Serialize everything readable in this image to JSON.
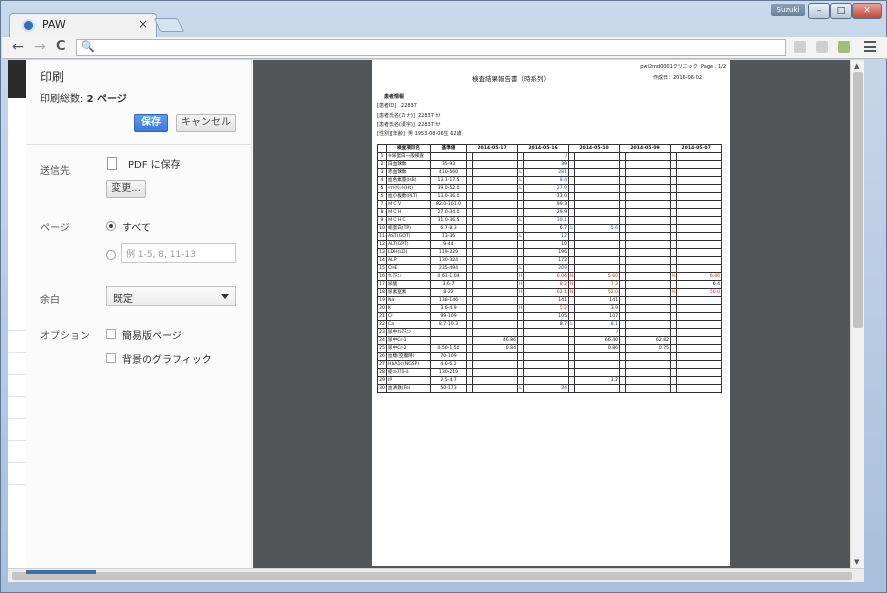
{
  "browser": {
    "tab_title": "PAW",
    "tab_close": "×",
    "user_badge": "Suzuki",
    "window_buttons": {
      "min": "–",
      "max": "□",
      "close": "✕"
    },
    "nav": {
      "back": "←",
      "forward": "→",
      "reload": "C",
      "search": "🔍"
    },
    "address": ""
  },
  "print": {
    "title": "印刷",
    "total_label": "印刷総数:",
    "total_value": "2 ページ",
    "save_button": "保存",
    "cancel_button": "キャンセル",
    "destination_label": "送信先",
    "destination_value": "PDF に保存",
    "change_button": "変更...",
    "pages_label": "ページ",
    "pages_all": "すべて",
    "pages_placeholder": "例 1-5, 8, 11-13",
    "margin_label": "余白",
    "margin_value": "既定",
    "options_label": "オプション",
    "option_simple": "簡易版ページ",
    "option_background": "背景のグラフィック"
  },
  "document": {
    "clinic": "pwi2md0001クリニック",
    "page_label": "Page : 1/2",
    "title": "検査結果報告書（時系列）",
    "created": "作成日：2016-06-02",
    "patient_section": "患者情報",
    "patient": [
      {
        "k": "[患者ID]",
        "v": "22837"
      },
      {
        "k": "[患者氏名(カナ)]",
        "v": "22837 ｶﾅ"
      },
      {
        "k": "[患者氏名(漢字)]",
        "v": "22837 ｶﾅ"
      },
      {
        "k": "[性別][年齢]",
        "v": "男 1953-08-06生 62歳"
      }
    ],
    "headers": [
      "",
      "検査項目名",
      "基準値",
      "2014-05-17",
      "2014-05-16",
      "2014-05-10",
      "2014-05-09",
      "2014-05-07"
    ],
    "rows": [
      {
        "n": "1",
        "name": "※尿蛋白一般検査",
        "ref": "",
        "v": [
          [
            "",
            ""
          ],
          [
            "",
            "/"
          ],
          [
            "",
            ""
          ],
          [
            "",
            ""
          ],
          [
            "",
            ""
          ]
        ]
      },
      {
        "n": "2",
        "name": "白血球数",
        "ref": "35-93",
        "v": [
          [
            "",
            ""
          ],
          [
            "",
            "39"
          ],
          [
            "",
            ""
          ],
          [
            "",
            ""
          ],
          [
            "",
            ""
          ]
        ]
      },
      {
        "n": "3",
        "name": "赤血球数",
        "ref": "410-560",
        "v": [
          [
            "",
            ""
          ],
          [
            "L",
            "281"
          ],
          [
            "",
            ""
          ],
          [
            "",
            ""
          ],
          [
            "",
            ""
          ]
        ]
      },
      {
        "n": "4",
        "name": "血色素量(HB)",
        "ref": "13.1-17.5",
        "v": [
          [
            "",
            ""
          ],
          [
            "L",
            "8.4"
          ],
          [
            "",
            ""
          ],
          [
            "",
            ""
          ],
          [
            "",
            ""
          ]
        ]
      },
      {
        "n": "5",
        "name": "ﾍﾏﾄｸﾘｯﾄ(Ht)",
        "ref": "39.0-52.0",
        "v": [
          [
            "",
            ""
          ],
          [
            "L",
            "27.9"
          ],
          [
            "",
            ""
          ],
          [
            "",
            ""
          ],
          [
            "",
            ""
          ]
        ]
      },
      {
        "n": "6",
        "name": "血小板数(PLT)",
        "ref": "13.0-36.0",
        "v": [
          [
            "",
            ""
          ],
          [
            "",
            "33.0"
          ],
          [
            "",
            ""
          ],
          [
            "",
            ""
          ],
          [
            "",
            ""
          ]
        ]
      },
      {
        "n": "7",
        "name": "ＭＣＶ",
        "ref": "82.0-101.0",
        "v": [
          [
            "",
            ""
          ],
          [
            "",
            "99.3"
          ],
          [
            "",
            ""
          ],
          [
            "",
            ""
          ],
          [
            "",
            ""
          ]
        ]
      },
      {
        "n": "8",
        "name": "ＭＣＨ",
        "ref": "27.0-34.0",
        "v": [
          [
            "",
            ""
          ],
          [
            "",
            "29.9"
          ],
          [
            "",
            ""
          ],
          [
            "",
            ""
          ],
          [
            "",
            ""
          ]
        ]
      },
      {
        "n": "9",
        "name": "ＭＣＨＣ",
        "ref": "31.0-36.5",
        "v": [
          [
            "",
            ""
          ],
          [
            "L",
            "30.1"
          ],
          [
            "",
            ""
          ],
          [
            "",
            ""
          ],
          [
            "",
            ""
          ]
        ]
      },
      {
        "n": "10",
        "name": "総蛋白(TP)",
        "ref": "6.7-8.3",
        "v": [
          [
            "",
            ""
          ],
          [
            "",
            "6.7"
          ],
          [
            "L",
            "5.6"
          ],
          [
            "",
            ""
          ],
          [
            "",
            ""
          ]
        ]
      },
      {
        "n": "11",
        "name": "AST(GOT)",
        "ref": "13-36",
        "v": [
          [
            "",
            ""
          ],
          [
            "L",
            "12"
          ],
          [
            "",
            ""
          ],
          [
            "",
            ""
          ],
          [
            "",
            ""
          ]
        ]
      },
      {
        "n": "12",
        "name": "ALT(GPT)",
        "ref": "9-44",
        "v": [
          [
            "",
            ""
          ],
          [
            "",
            "10"
          ],
          [
            "",
            ""
          ],
          [
            "",
            ""
          ],
          [
            "",
            ""
          ]
        ]
      },
      {
        "n": "13",
        "name": "LDH(LD)",
        "ref": "119-229",
        "v": [
          [
            "",
            ""
          ],
          [
            "",
            "196"
          ],
          [
            "",
            ""
          ],
          [
            "",
            ""
          ],
          [
            "",
            ""
          ]
        ]
      },
      {
        "n": "14",
        "name": "ALP",
        "ref": "130-324",
        "v": [
          [
            "",
            ""
          ],
          [
            "",
            "172"
          ],
          [
            "",
            ""
          ],
          [
            "",
            ""
          ],
          [
            "",
            ""
          ]
        ]
      },
      {
        "n": "15",
        "name": "CHE",
        "ref": "235-494",
        "v": [
          [
            "",
            ""
          ],
          [
            "L",
            "209"
          ],
          [
            "",
            ""
          ],
          [
            "",
            ""
          ],
          [
            "",
            ""
          ]
        ]
      },
      {
        "n": "16",
        "name": "ｸﾚｱﾁﾆﾝ",
        "ref": "0.61-1.04",
        "v": [
          [
            "",
            ""
          ],
          [
            "H",
            "6.06"
          ],
          [
            "H",
            "5.60"
          ],
          [
            "",
            ""
          ],
          [
            "H",
            "6.06"
          ]
        ]
      },
      {
        "n": "17",
        "name": "尿酸",
        "ref": "3.6-7",
        "v": [
          [
            "",
            ""
          ],
          [
            "H",
            "8.2"
          ],
          [
            "H",
            "7.3"
          ],
          [
            "",
            ""
          ],
          [
            "",
            "6.4"
          ]
        ]
      },
      {
        "n": "18",
        "name": "尿素窒素",
        "ref": "8-22",
        "v": [
          [
            "",
            ""
          ],
          [
            "H",
            "62.1"
          ],
          [
            "H",
            "52.0"
          ],
          [
            "",
            ""
          ],
          [
            "H",
            "50.0"
          ]
        ]
      },
      {
        "n": "19",
        "name": "Na",
        "ref": "138-146",
        "v": [
          [
            "",
            ""
          ],
          [
            "",
            "141"
          ],
          [
            "",
            "141"
          ],
          [
            "",
            ""
          ],
          [
            "",
            ""
          ]
        ]
      },
      {
        "n": "20",
        "name": "K",
        "ref": "3.6-4.9",
        "v": [
          [
            "",
            ""
          ],
          [
            "H",
            "5.2"
          ],
          [
            "",
            "3.9"
          ],
          [
            "",
            ""
          ],
          [
            "",
            ""
          ]
        ]
      },
      {
        "n": "21",
        "name": "Cl",
        "ref": "99-109",
        "v": [
          [
            "",
            ""
          ],
          [
            "",
            "105"
          ],
          [
            "",
            "107"
          ],
          [
            "",
            ""
          ],
          [
            "",
            ""
          ]
        ]
      },
      {
        "n": "22",
        "name": "Ca",
        "ref": "8.7-10.3",
        "v": [
          [
            "",
            ""
          ],
          [
            "",
            "8.7"
          ],
          [
            "L",
            "8.1"
          ],
          [
            "",
            ""
          ],
          [
            "",
            ""
          ]
        ]
      },
      {
        "n": "23",
        "name": "尿中ｸﾚｱﾁﾆﾝ",
        "ref": "",
        "v": [
          [
            "",
            ""
          ],
          [
            "",
            ""
          ],
          [
            "",
            "/"
          ],
          [
            "",
            ""
          ],
          [
            "",
            ""
          ]
        ]
      },
      {
        "n": "24",
        "name": "尿中Cr-1",
        "ref": "",
        "v": [
          [
            "",
            "46.86"
          ],
          [
            "",
            ""
          ],
          [
            "",
            "66.40"
          ],
          [
            "",
            "62.82"
          ],
          [
            "",
            ""
          ]
        ]
      },
      {
        "n": "25",
        "name": "尿中Cr-2",
        "ref": "0.50-1.50",
        "v": [
          [
            "",
            "0.84"
          ],
          [
            "",
            ""
          ],
          [
            "",
            "0.86"
          ],
          [
            "",
            "0.75"
          ],
          [
            "",
            ""
          ]
        ]
      },
      {
        "n": "26",
        "name": "血糖(空腹時)",
        "ref": "70-109",
        "v": [
          [
            "",
            ""
          ],
          [
            "",
            ""
          ],
          [
            "",
            ""
          ],
          [
            "",
            ""
          ],
          [
            "",
            ""
          ]
        ]
      },
      {
        "n": "27",
        "name": "HbA1c(NGSP)",
        "ref": "4.6-6.2",
        "v": [
          [
            "",
            ""
          ],
          [
            "",
            ""
          ],
          [
            "",
            ""
          ],
          [
            "",
            ""
          ],
          [
            "",
            ""
          ]
        ]
      },
      {
        "n": "28",
        "name": "総ｺﾚｽﾃﾛｰﾙ",
        "ref": "130-219",
        "v": [
          [
            "",
            ""
          ],
          [
            "",
            ""
          ],
          [
            "",
            ""
          ],
          [
            "",
            ""
          ],
          [
            "",
            ""
          ]
        ]
      },
      {
        "n": "29",
        "name": "IP",
        "ref": "2.5-4.7",
        "v": [
          [
            "",
            ""
          ],
          [
            "",
            ""
          ],
          [
            "",
            "3.2"
          ],
          [
            "",
            ""
          ],
          [
            "",
            ""
          ]
        ]
      },
      {
        "n": "30",
        "name": "血清鉄(Fe)",
        "ref": "50-173",
        "v": [
          [
            "",
            ""
          ],
          [
            "L",
            "34"
          ],
          [
            "",
            ""
          ],
          [
            "",
            ""
          ],
          [
            "",
            ""
          ]
        ]
      }
    ]
  },
  "colors": {
    "low": "#1a3bd6",
    "high": "#d61a1a",
    "save": "#3a7ae0"
  }
}
